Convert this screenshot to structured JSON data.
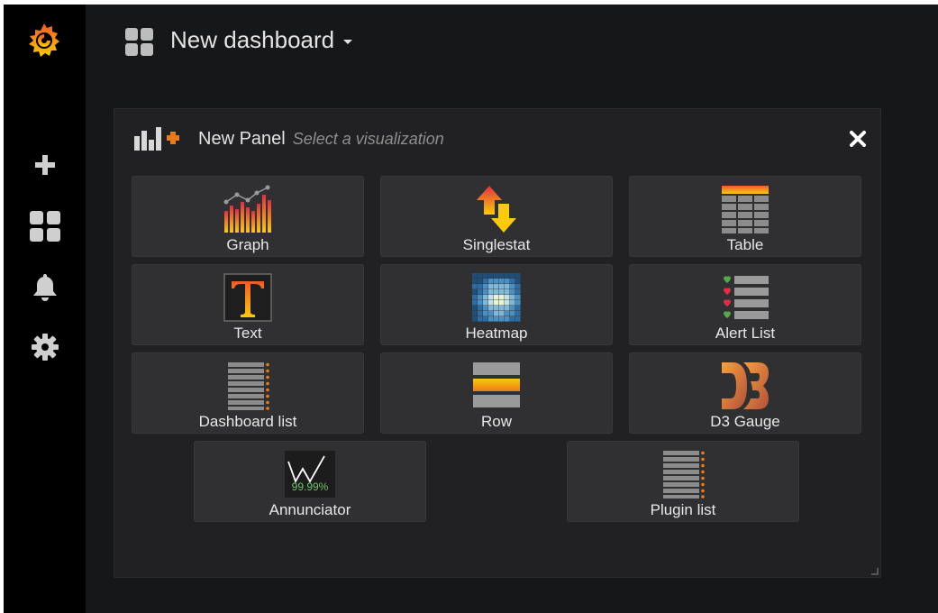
{
  "navbar": {
    "title": "New dashboard"
  },
  "sidemenu": {
    "items": [
      {
        "name": "create",
        "icon": "plus-icon"
      },
      {
        "name": "dashboards",
        "icon": "dashboards-grid-icon"
      },
      {
        "name": "alerting",
        "icon": "bell-icon"
      },
      {
        "name": "configuration",
        "icon": "gear-icon"
      }
    ]
  },
  "panel": {
    "title": "New Panel",
    "subtitle": "Select a visualization",
    "visualizations": [
      {
        "label": "Graph",
        "icon": "graph-icon"
      },
      {
        "label": "Singlestat",
        "icon": "singlestat-icon"
      },
      {
        "label": "Table",
        "icon": "table-icon"
      },
      {
        "label": "Text",
        "icon": "text-icon"
      },
      {
        "label": "Heatmap",
        "icon": "heatmap-icon"
      },
      {
        "label": "Alert List",
        "icon": "alert-list-icon"
      },
      {
        "label": "Dashboard list",
        "icon": "dashboard-list-icon"
      },
      {
        "label": "Row",
        "icon": "row-icon"
      },
      {
        "label": "D3 Gauge",
        "icon": "d3-gauge-icon"
      },
      {
        "label": "Annunciator",
        "icon": "annunciator-icon",
        "value_text": "99.99%"
      },
      {
        "label": "Plugin list",
        "icon": "plugin-list-icon"
      }
    ]
  },
  "colors": {
    "background": "#161719",
    "sidemenu": "#000000",
    "panel": "#212124",
    "card": "#303033",
    "accent_orange": "#eb7b18",
    "accent_yellow": "#fbca0a"
  }
}
